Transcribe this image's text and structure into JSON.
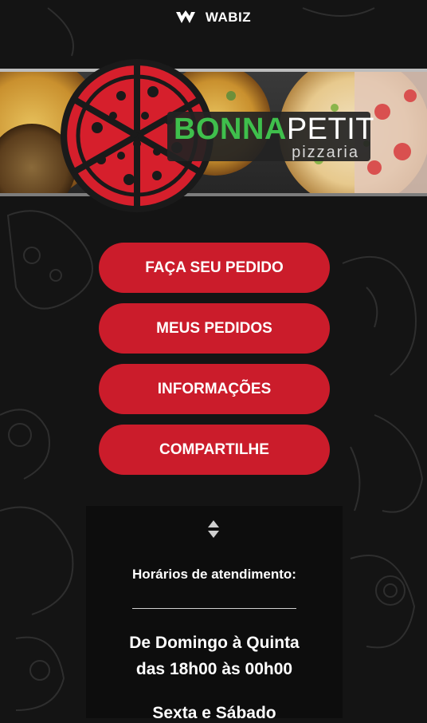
{
  "app": {
    "brand_logo_text": "WABIZ"
  },
  "banner": {
    "brand_name_part1": "BONNA",
    "brand_name_part2": "PETIT",
    "brand_subtitle": "pizzaria",
    "accent_red": "#cb1c2b",
    "accent_green": "#3fbf4c"
  },
  "menu": {
    "items": [
      {
        "label": "FAÇA SEU PEDIDO"
      },
      {
        "label": "MEUS PEDIDOS"
      },
      {
        "label": "INFORMAÇÕES"
      },
      {
        "label": "COMPARTILHE"
      }
    ]
  },
  "info": {
    "expand_icon": "sort-arrows-icon",
    "title": "Horários de atendimento:",
    "schedule": [
      {
        "days": "De Domingo à Quinta",
        "hours": "das 18h00 às 00h00"
      },
      {
        "days": "Sexta e Sábado"
      }
    ]
  }
}
